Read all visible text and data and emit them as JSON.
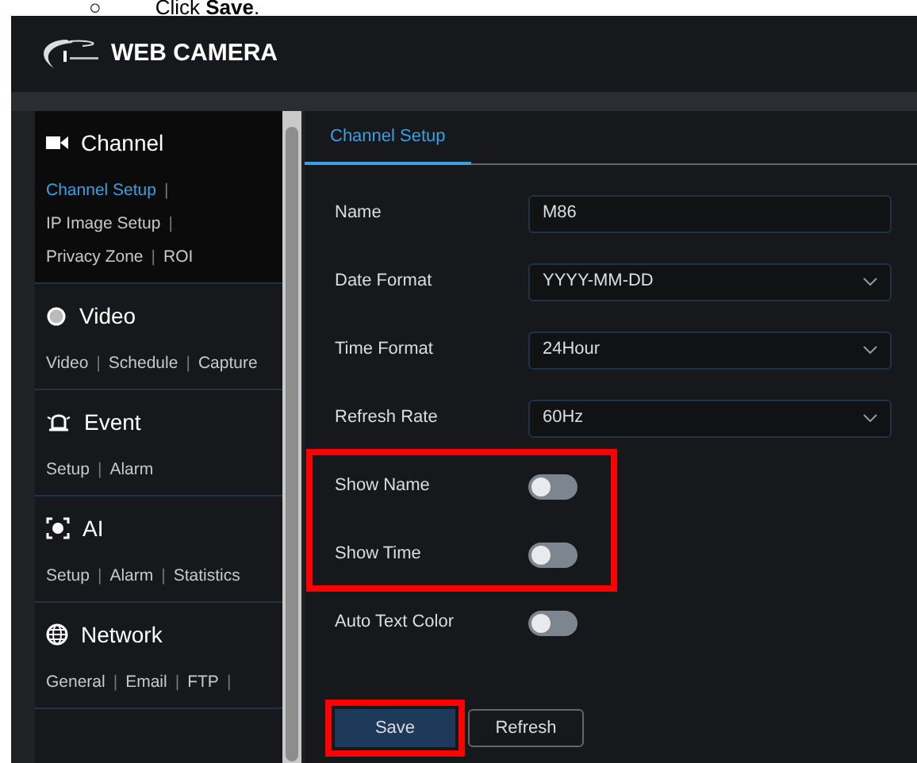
{
  "document_note": {
    "bullet": "○",
    "text": "Click **Save**."
  },
  "header": {
    "title": "WEB CAMERA"
  },
  "sidebar": {
    "separator": "|",
    "sections": [
      {
        "title": "Channel",
        "selected": true,
        "links": [
          {
            "label": "Channel Setup",
            "selected": true
          },
          {
            "label": "IP Image Setup",
            "selected": false
          },
          {
            "label": "Privacy Zone",
            "selected": false
          },
          {
            "label": "ROI",
            "selected": false
          }
        ]
      },
      {
        "title": "Video",
        "selected": false,
        "links": [
          {
            "label": "Video",
            "selected": false
          },
          {
            "label": "Schedule",
            "selected": false
          },
          {
            "label": "Capture",
            "selected": false
          }
        ]
      },
      {
        "title": "Event",
        "selected": false,
        "links": [
          {
            "label": "Setup",
            "selected": false
          },
          {
            "label": "Alarm",
            "selected": false
          }
        ]
      },
      {
        "title": "AI",
        "selected": false,
        "links": [
          {
            "label": "Setup",
            "selected": false
          },
          {
            "label": "Alarm",
            "selected": false
          },
          {
            "label": "Statistics",
            "selected": false
          }
        ]
      },
      {
        "title": "Network",
        "selected": false,
        "trailing_separator": true,
        "links": [
          {
            "label": "General",
            "selected": false
          },
          {
            "label": "Email",
            "selected": false
          },
          {
            "label": "FTP",
            "selected": false
          }
        ]
      }
    ]
  },
  "tabs": [
    {
      "label": "Channel Setup",
      "selected": true
    }
  ],
  "form": {
    "rows": [
      {
        "kind": "text",
        "label": "Name",
        "value": "M86"
      },
      {
        "kind": "select",
        "label": "Date Format",
        "value": "YYYY-MM-DD"
      },
      {
        "kind": "select",
        "label": "Time Format",
        "value": "24Hour"
      },
      {
        "kind": "select",
        "label": "Refresh Rate",
        "value": "60Hz"
      },
      {
        "kind": "toggle",
        "label": "Show Name",
        "on": false,
        "highlighted": true
      },
      {
        "kind": "toggle",
        "label": "Show Time",
        "on": false,
        "highlighted": true
      },
      {
        "kind": "toggle",
        "label": "Auto Text Color",
        "on": false
      }
    ],
    "buttons": [
      {
        "label": "Save",
        "kind": "primary",
        "highlighted": true
      },
      {
        "label": "Refresh",
        "kind": "secondary",
        "highlighted": false
      }
    ]
  }
}
